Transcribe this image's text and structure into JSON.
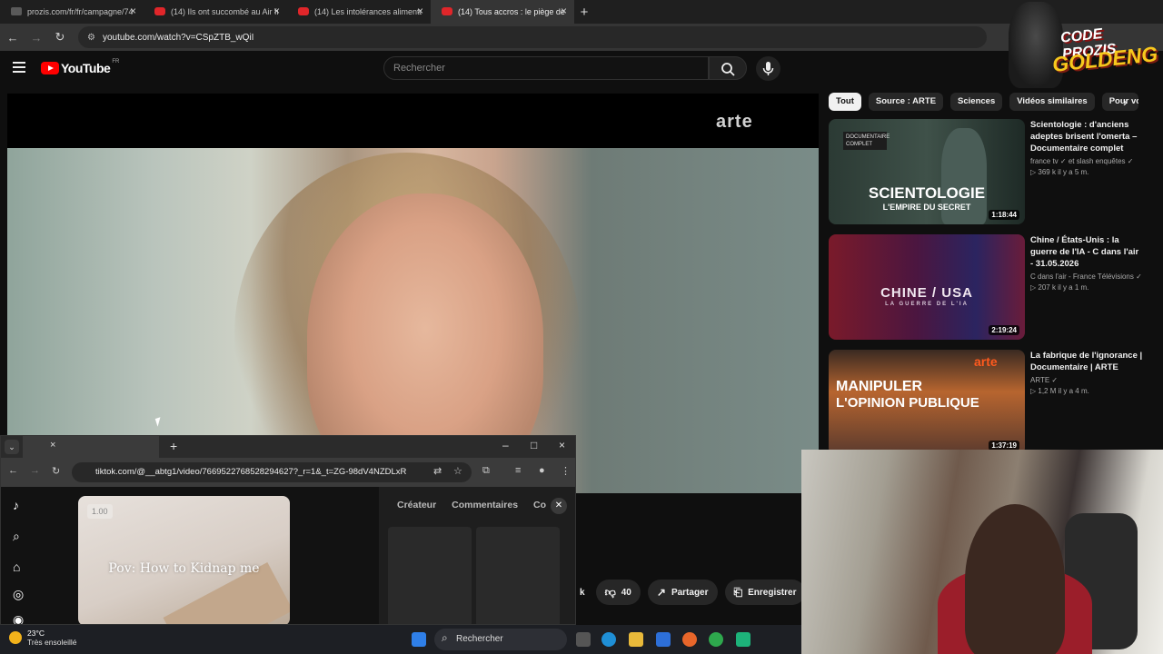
{
  "browser": {
    "tabs": [
      {
        "title": "prozis.com/fr/fr/campagne/74",
        "favicon": "prozis"
      },
      {
        "title": "(14) Ils ont succombé au Air fry",
        "favicon": "youtube"
      },
      {
        "title": "(14) Les intolérances alimentai",
        "favicon": "youtube"
      },
      {
        "title": "(14) Tous accros : le piège des a",
        "favicon": "youtube",
        "active": true
      }
    ],
    "url": "youtube.com/watch?v=CSpZTB_wQiI"
  },
  "youtube": {
    "logo_text": "YouTube",
    "region": "FR",
    "search_placeholder": "Rechercher",
    "player_watermark": "arte",
    "chips": [
      "Tout",
      "Source : ARTE",
      "Sciences",
      "Vidéos similaires",
      "Pour vo"
    ],
    "actions": {
      "likes_partial": "k",
      "dislike_count": "40",
      "share": "Partager",
      "save": "Enregistrer"
    },
    "recommendations": [
      {
        "thumb_text_1": "SCIENTOLOGIE",
        "thumb_text_2": "L'EMPIRE DU SECRET",
        "thumb_badge": "DOCUMENTAIRE COMPLET",
        "duration": "1:18:44",
        "title": "Scientologie : d'anciens adeptes brisent l'omerta – Documentaire complet",
        "channel": "france tv ✓ et slash enquêtes ✓",
        "stats": "▷ 369 k  il y a 5 m."
      },
      {
        "thumb_text_1": "CHINE / USA",
        "thumb_text_2": "LA GUERRE DE L'IA",
        "duration": "2:19:24",
        "title": "Chine / États-Unis : la guerre de l'IA  -  C dans l'air - 31.05.2026",
        "channel": "C dans l'air - France Télévisions ✓",
        "stats": "▷ 207 k  il y a 1 m."
      },
      {
        "thumb_text_1": "MANIPULER",
        "thumb_text_2": "L'OPINION PUBLIQUE",
        "thumb_badge": "arte",
        "duration": "1:37:19",
        "title": "La fabrique de l'ignorance | Documentaire | ARTE",
        "channel": "ARTE ✓",
        "stats": "▷ 1,2 M  il y a 4 m."
      }
    ]
  },
  "promo": {
    "line1": "CODE PROZIS",
    "line2": "GOLDENG"
  },
  "tiktok_window": {
    "url": "tiktok.com/@__abtg1/video/7669522768528294627?_r=1&_t=ZG-98dV4NZDLxR",
    "speed": "1.00",
    "caption": "Pov: How to Kidnap me",
    "panel_tabs": [
      "Créateur",
      "Commentaires",
      "Co"
    ]
  },
  "taskbar": {
    "temperature": "23°C",
    "weather": "Très ensoleillé",
    "search": "Rechercher"
  }
}
